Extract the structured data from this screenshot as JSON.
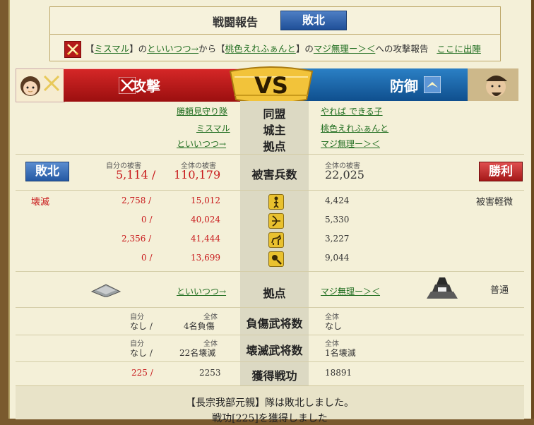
{
  "report": {
    "title": "戦闘報告",
    "result": "敗北",
    "attack_line": {
      "p1": "【",
      "attacker": "ミスマル",
      "p2": "】の",
      "attacker_base": "といいつつ→",
      "p3": "から【",
      "defender": "桃色えれふぁんと",
      "p4": "】の",
      "defender_base": "マジ無理ー＞＜",
      "p5": "への攻撃報告",
      "deploy_link": "ここに出陣"
    }
  },
  "vs": {
    "attack_label": "攻撃",
    "defense_label": "防御",
    "vs_text": "VS"
  },
  "info": {
    "labels": {
      "alliance": "同盟",
      "lord": "城主",
      "base": "拠点"
    },
    "attacker": {
      "alliance": "勝頼見守り隊",
      "lord": "ミスマル",
      "base": "といいつつ→"
    },
    "defender": {
      "alliance": "やれば できる子",
      "lord": "桃色えれふぁんと",
      "base": "マジ無理ー＞＜"
    }
  },
  "losses": {
    "label": "被害兵数",
    "attacker": {
      "result": "敗北",
      "own_label": "自分の被害",
      "total_label": "全体の被害",
      "own": "5,114 /",
      "total": "110,179",
      "status": "壊滅"
    },
    "defender": {
      "result": "勝利",
      "total_label": "全体の被害",
      "total": "22,025",
      "status": "被害軽微"
    },
    "units": [
      {
        "icon": "infantry-icon",
        "own": "2,758 /",
        "total": "15,012",
        "def": "4,424"
      },
      {
        "icon": "archer-icon",
        "own": "0 /",
        "total": "40,024",
        "def": "5,330"
      },
      {
        "icon": "cavalry-icon",
        "own": "2,356 /",
        "total": "41,444",
        "def": "3,227"
      },
      {
        "icon": "siege-icon",
        "own": "0 /",
        "total": "13,699",
        "def": "9,044"
      }
    ]
  },
  "base_row": {
    "label": "拠点",
    "attacker_base": "といいつつ→",
    "defender_base": "マジ無理ー＞＜",
    "defender_status": "普通"
  },
  "wounded": {
    "label": "負傷武将数",
    "own_label": "自分",
    "total_label": "全体",
    "own": "なし /",
    "total": "4名負傷",
    "def_total_label": "全体",
    "def": "なし"
  },
  "destroyed": {
    "label": "壊滅武将数",
    "own_label": "自分",
    "total_label": "全体",
    "own": "なし /",
    "total": "22名壊滅",
    "def_total_label": "全体",
    "def": "1名壊滅"
  },
  "merit": {
    "label": "獲得戦功",
    "own": "225 /",
    "total": "2253",
    "def": "18891"
  },
  "footer": {
    "line1": "【長宗我部元親】隊は敗北しました。",
    "line2": "戦功[225]を獲得しました"
  },
  "colors": {
    "attack": "#c81a1a",
    "defense": "#1f5fa0",
    "link": "#1f6d1f"
  }
}
